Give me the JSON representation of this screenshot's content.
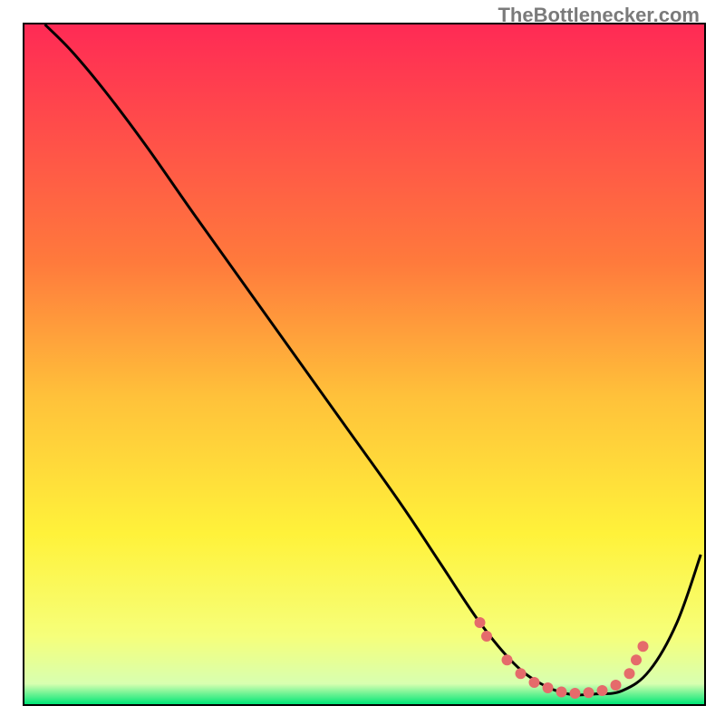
{
  "watermark": "TheBottlenecker.com",
  "chart_data": {
    "type": "line",
    "title": "",
    "xlabel": "",
    "ylabel": "",
    "xlim": [
      0,
      100
    ],
    "ylim": [
      0,
      100
    ],
    "gradient_colors": [
      {
        "stop": 0,
        "color": "#ff2a55"
      },
      {
        "stop": 35,
        "color": "#ff7a3c"
      },
      {
        "stop": 55,
        "color": "#ffc23a"
      },
      {
        "stop": 75,
        "color": "#fff23a"
      },
      {
        "stop": 90,
        "color": "#f6ff7a"
      },
      {
        "stop": 97,
        "color": "#d8ffb0"
      },
      {
        "stop": 100,
        "color": "#00e676"
      }
    ],
    "series": [
      {
        "name": "bottleneck-curve",
        "color": "#000000",
        "x": [
          3,
          7,
          12,
          18,
          25,
          35,
          45,
          55,
          61,
          67,
          72,
          76,
          80,
          84,
          88,
          92,
          96,
          99.5
        ],
        "y": [
          100,
          96,
          90,
          82,
          72,
          58,
          44,
          30,
          21,
          12,
          6,
          3,
          1.5,
          1.5,
          2,
          5,
          12,
          22
        ]
      }
    ],
    "highlight_points": {
      "name": "optimal-range-dots",
      "color": "#e56b6b",
      "x": [
        67,
        68,
        71,
        73,
        75,
        77,
        79,
        81,
        83,
        85,
        87,
        89,
        90,
        91
      ],
      "y": [
        12,
        10,
        6.5,
        4.5,
        3.2,
        2.4,
        1.8,
        1.6,
        1.7,
        2.0,
        2.8,
        4.5,
        6.5,
        8.5
      ]
    }
  }
}
